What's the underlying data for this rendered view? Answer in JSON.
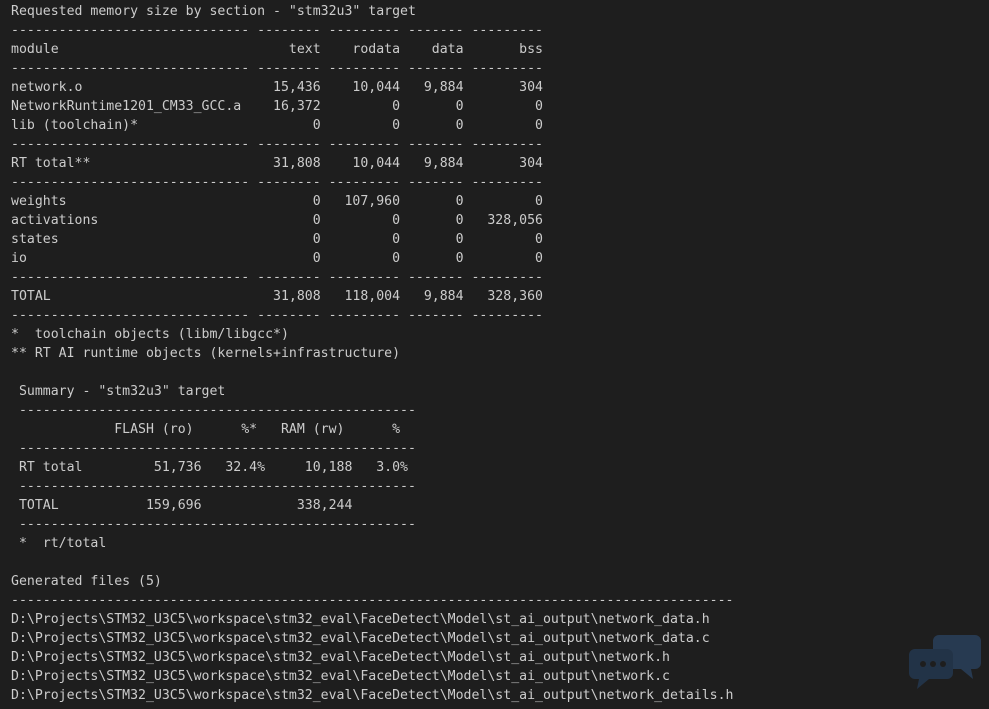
{
  "colors": {
    "background": "#1e1e1e",
    "text": "#cccccc",
    "watermark": "#3a6fb0"
  },
  "icons": {
    "watermark": "chat-bubbles-icon"
  },
  "lines": [
    "Requested memory size by section - \"stm32u3\" target",
    "------------------------------ -------- --------- ------- ---------",
    "module                             text    rodata    data       bss",
    "------------------------------ -------- --------- ------- ---------",
    "network.o                        15,436    10,044   9,884       304",
    "NetworkRuntime1201_CM33_GCC.a    16,372         0       0         0",
    "lib (toolchain)*                      0         0       0         0",
    "------------------------------ -------- --------- ------- ---------",
    "RT total**                       31,808    10,044   9,884       304",
    "------------------------------ -------- --------- ------- ---------",
    "weights                               0   107,960       0         0",
    "activations                           0         0       0   328,056",
    "states                                0         0       0         0",
    "io                                    0         0       0         0",
    "------------------------------ -------- --------- ------- ---------",
    "TOTAL                            31,808   118,004   9,884   328,360",
    "------------------------------ -------- --------- ------- ---------",
    "*  toolchain objects (libm/libgcc*)",
    "** RT AI runtime objects (kernels+infrastructure)",
    "",
    " Summary - \"stm32u3\" target",
    " --------------------------------------------------",
    "             FLASH (ro)      %*   RAM (rw)      %",
    " --------------------------------------------------",
    " RT total         51,736   32.4%     10,188   3.0%",
    " --------------------------------------------------",
    " TOTAL           159,696            338,244",
    " --------------------------------------------------",
    " *  rt/total",
    "",
    "Generated files (5)",
    "-------------------------------------------------------------------------------------------",
    "D:\\Projects\\STM32_U3C5\\workspace\\stm32_eval\\FaceDetect\\Model\\st_ai_output\\network_data.h",
    "D:\\Projects\\STM32_U3C5\\workspace\\stm32_eval\\FaceDetect\\Model\\st_ai_output\\network_data.c",
    "D:\\Projects\\STM32_U3C5\\workspace\\stm32_eval\\FaceDetect\\Model\\st_ai_output\\network.h",
    "D:\\Projects\\STM32_U3C5\\workspace\\stm32_eval\\FaceDetect\\Model\\st_ai_output\\network.c",
    "D:\\Projects\\STM32_U3C5\\workspace\\stm32_eval\\FaceDetect\\Model\\st_ai_output\\network_details.h"
  ]
}
